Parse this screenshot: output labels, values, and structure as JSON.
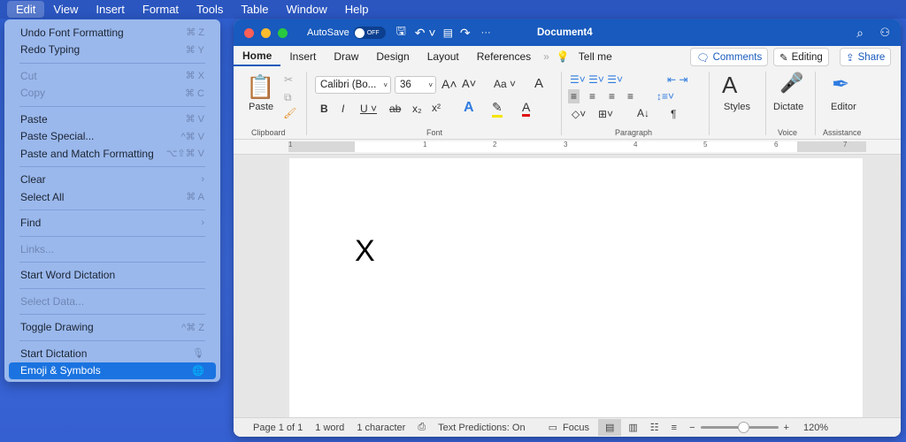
{
  "menubar": [
    "Edit",
    "View",
    "Insert",
    "Format",
    "Tools",
    "Table",
    "Window",
    "Help"
  ],
  "edit_menu": [
    {
      "label": "Undo Font Formatting",
      "shortcut": "⌘ Z",
      "enabled": true
    },
    {
      "label": "Redo Typing",
      "shortcut": "⌘ Y",
      "enabled": true
    },
    {
      "sep": true
    },
    {
      "label": "Cut",
      "shortcut": "⌘ X",
      "enabled": false
    },
    {
      "label": "Copy",
      "shortcut": "⌘ C",
      "enabled": false
    },
    {
      "sep": true
    },
    {
      "label": "Paste",
      "shortcut": "⌘ V",
      "enabled": true
    },
    {
      "label": "Paste Special...",
      "shortcut": "^⌘ V",
      "enabled": true
    },
    {
      "label": "Paste and Match Formatting",
      "shortcut": "⌥⇧⌘ V",
      "enabled": true
    },
    {
      "sep": true
    },
    {
      "label": "Clear",
      "shortcut": "›",
      "enabled": true
    },
    {
      "label": "Select All",
      "shortcut": "⌘ A",
      "enabled": true
    },
    {
      "sep": true
    },
    {
      "label": "Find",
      "shortcut": "›",
      "enabled": true
    },
    {
      "sep": true
    },
    {
      "label": "Links...",
      "shortcut": "",
      "enabled": false
    },
    {
      "sep": true
    },
    {
      "label": "Start Word Dictation",
      "shortcut": "",
      "enabled": true
    },
    {
      "sep": true
    },
    {
      "label": "Select Data...",
      "shortcut": "",
      "enabled": false
    },
    {
      "sep": true
    },
    {
      "label": "Toggle Drawing",
      "shortcut": "^⌘ Z",
      "enabled": true
    },
    {
      "sep": true
    },
    {
      "label": "Start Dictation",
      "shortcut": "🎙",
      "enabled": true
    },
    {
      "label": "Emoji & Symbols",
      "shortcut": "🌐",
      "enabled": true,
      "selected": true
    }
  ],
  "window": {
    "title": "Document4",
    "autosave": "AutoSave",
    "autosave_state": "OFF"
  },
  "tabs": [
    "Home",
    "Insert",
    "Draw",
    "Design",
    "Layout",
    "References"
  ],
  "tell_me": "Tell me",
  "buttons": {
    "comments": "Comments",
    "editing": "Editing",
    "share": "Share"
  },
  "ribbon": {
    "paste": "Paste",
    "font_name": "Calibri (Bo...",
    "font_size": "36",
    "styles": "Styles",
    "dictate": "Dictate",
    "editor": "Editor",
    "groups": {
      "clipboard": "Clipboard",
      "font": "Font",
      "paragraph": "Paragraph",
      "voice": "Voice",
      "assistance": "Assistance"
    }
  },
  "ruler_numbers": [
    "1",
    "1",
    "2",
    "3",
    "4",
    "5",
    "6",
    "7"
  ],
  "document": {
    "text": "X"
  },
  "status": {
    "page": "Page 1 of 1",
    "words": "1 word",
    "chars": "1 character",
    "predictions": "Text Predictions: On",
    "focus": "Focus",
    "zoom": "120%"
  },
  "zoom_fraction": 0.55
}
